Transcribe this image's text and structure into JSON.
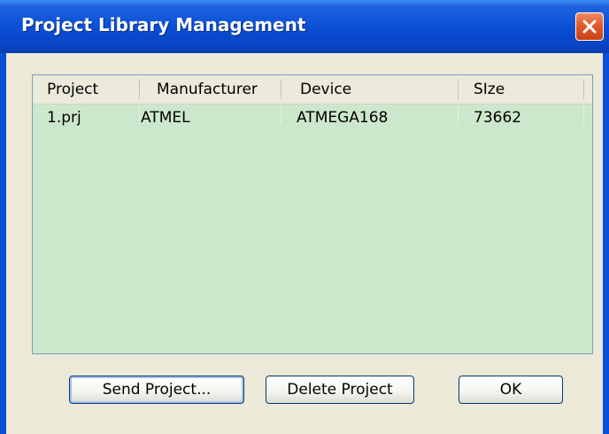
{
  "window": {
    "title": "Project Library Management"
  },
  "listview": {
    "columns": [
      "Project",
      "Manufacturer",
      "Device",
      "SIze"
    ],
    "rows": [
      {
        "project": "1.prj",
        "manufacturer": "ATMEL",
        "device": "ATMEGA168",
        "size": "73662"
      }
    ]
  },
  "buttons": {
    "send": "Send Project...",
    "delete": "Delete Project",
    "ok": "OK"
  },
  "colors": {
    "title_bar": "#0a4fd6",
    "list_background": "#cce8cc",
    "close_button": "#e25a2a"
  }
}
